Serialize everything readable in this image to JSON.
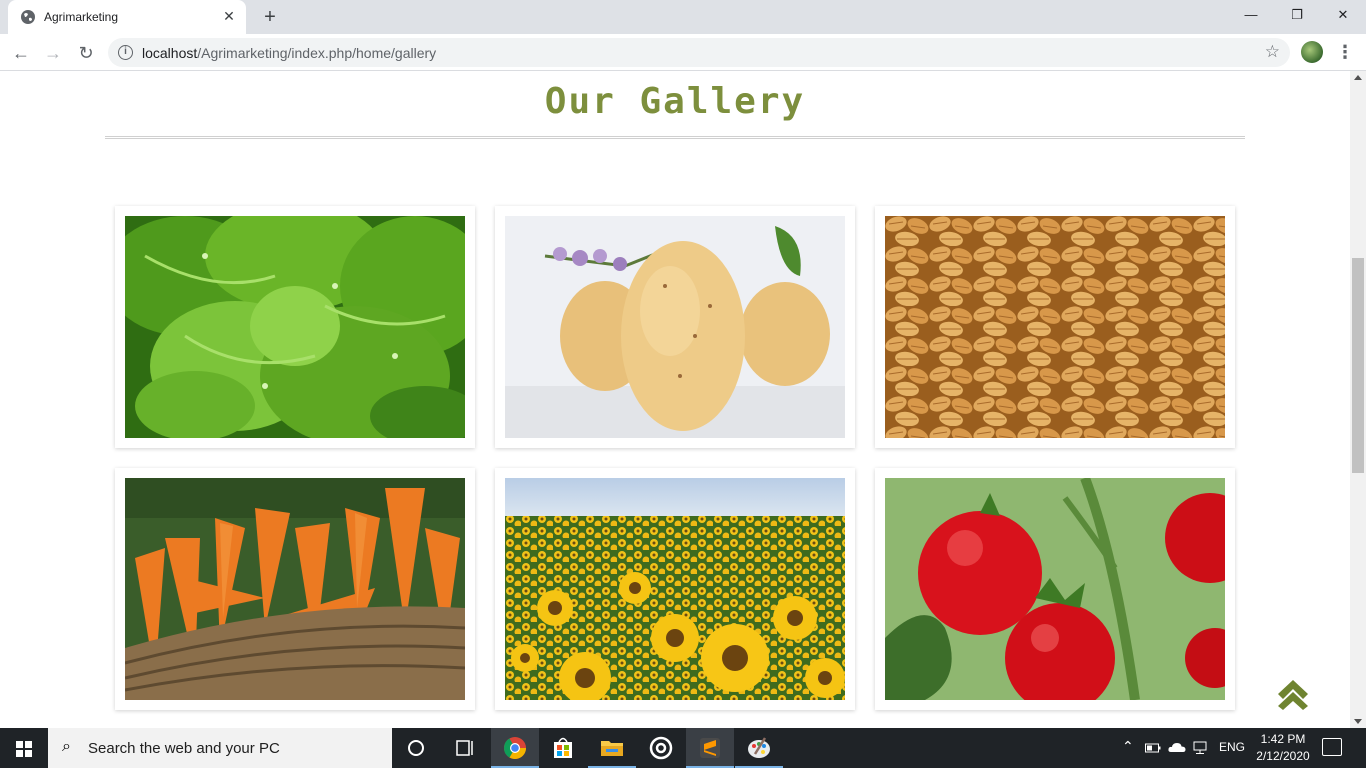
{
  "browser": {
    "tab_title": "Agrimarketing",
    "tab_close": "✕",
    "new_tab": "+",
    "url_host": "localhost",
    "url_path": "/Agrimarketing/index.php/home/gallery",
    "window_controls": {
      "minimize": "—",
      "restore": "❐",
      "close": "✕"
    },
    "nav": {
      "back": "←",
      "forward": "→",
      "reload": "↻"
    }
  },
  "page": {
    "title": "Our Gallery",
    "accent_color": "#7d8f3d",
    "gallery": [
      {
        "subject": "lettuce"
      },
      {
        "subject": "potatoes"
      },
      {
        "subject": "wheat"
      },
      {
        "subject": "carrots"
      },
      {
        "subject": "sunflowers"
      },
      {
        "subject": "tomatoes"
      }
    ],
    "scroll_top_icon": "double-chevron-up-icon"
  },
  "taskbar": {
    "search_placeholder": "Search the web and your PC",
    "language": "ENG",
    "time": "1:42 PM",
    "date": "2/12/2020"
  }
}
